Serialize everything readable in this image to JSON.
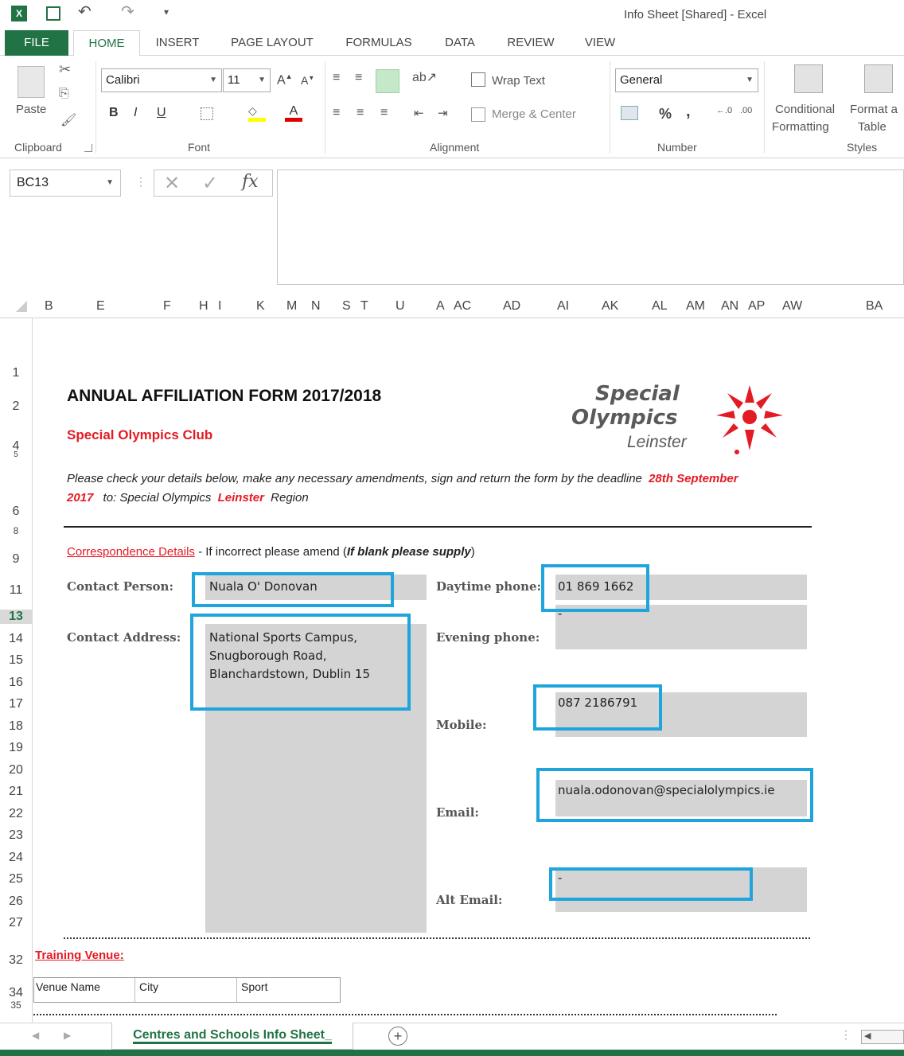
{
  "window": {
    "title": "Info Sheet  [Shared] - Excel"
  },
  "ribbon_tabs": [
    "FILE",
    "HOME",
    "INSERT",
    "PAGE LAYOUT",
    "FORMULAS",
    "DATA",
    "REVIEW",
    "VIEW"
  ],
  "ribbon": {
    "paste": "Paste",
    "font_name": "Calibri",
    "font_size": "11",
    "bold": "B",
    "italic": "I",
    "underline": "U",
    "wrap_text": "Wrap Text",
    "merge_center": "Merge & Center",
    "number_format": "General",
    "percent": "%",
    "comma": ",",
    "conditional_formatting_1": "Conditional",
    "conditional_formatting_2": "Formatting",
    "format_table_1": "Format a",
    "format_table_2": "Table",
    "groups": [
      "Clipboard",
      "Font",
      "Alignment",
      "Number",
      "Styles"
    ]
  },
  "formula_bar": {
    "name_box": "BC13",
    "fx": "fx",
    "value": ""
  },
  "columns": [
    "B",
    "E",
    "F",
    "H",
    "I",
    "K",
    "M",
    "N",
    "S",
    "T",
    "U",
    "A",
    "AC",
    "AD",
    "AI",
    "AK",
    "AL",
    "AM",
    "AN",
    "AP",
    "AW",
    "BA"
  ],
  "rows": [
    "1",
    "2",
    "4",
    "5",
    "6",
    "8",
    "9",
    "11",
    "13",
    "14",
    "15",
    "16",
    "17",
    "18",
    "19",
    "20",
    "21",
    "22",
    "23",
    "24",
    "25",
    "26",
    "27",
    "32",
    "34",
    "35"
  ],
  "form": {
    "title": "ANNUAL AFFILIATION FORM 2017/2018",
    "club": "Special Olympics Club",
    "instruction_main": "Please check your details below, make any necessary amendments, sign and return the form by the deadline",
    "deadline_1": "28th September",
    "deadline_2": "2017",
    "to_text": "to: Special Olympics",
    "region": "Leinster",
    "region_suffix": "Region",
    "logo_line1": "Special",
    "logo_line2": "Olympics",
    "logo_line3": "Leinster",
    "correspondence_heading": "Correspondence Details",
    "correspondence_note_1": " - If incorrect please amend (",
    "correspondence_note_2": "If blank please supply",
    "correspondence_note_3": ")",
    "contact_person_label": "Contact Person:",
    "contact_person": "Nuala O' Donovan",
    "contact_address_label": "Contact Address:",
    "address_line1": "National Sports Campus,",
    "address_line2": "Snugborough Road,",
    "address_line3": "Blanchardstown, Dublin 15",
    "daytime_label": "Daytime phone:",
    "daytime_phone": "01 869 1662",
    "evening_label": "Evening phone:",
    "evening_phone": "-",
    "mobile_label": "Mobile:",
    "mobile": "087 2186791",
    "email_label": "Email:",
    "email": "nuala.odonovan@specialolympics.ie",
    "alt_email_label": "Alt Email:",
    "alt_email": "-",
    "training_heading": "Training Venue:",
    "venue_cols": [
      "Venue Name",
      "City",
      "Sport"
    ]
  },
  "sheet_tabs": {
    "active": "Centres and Schools Info Sheet_"
  }
}
